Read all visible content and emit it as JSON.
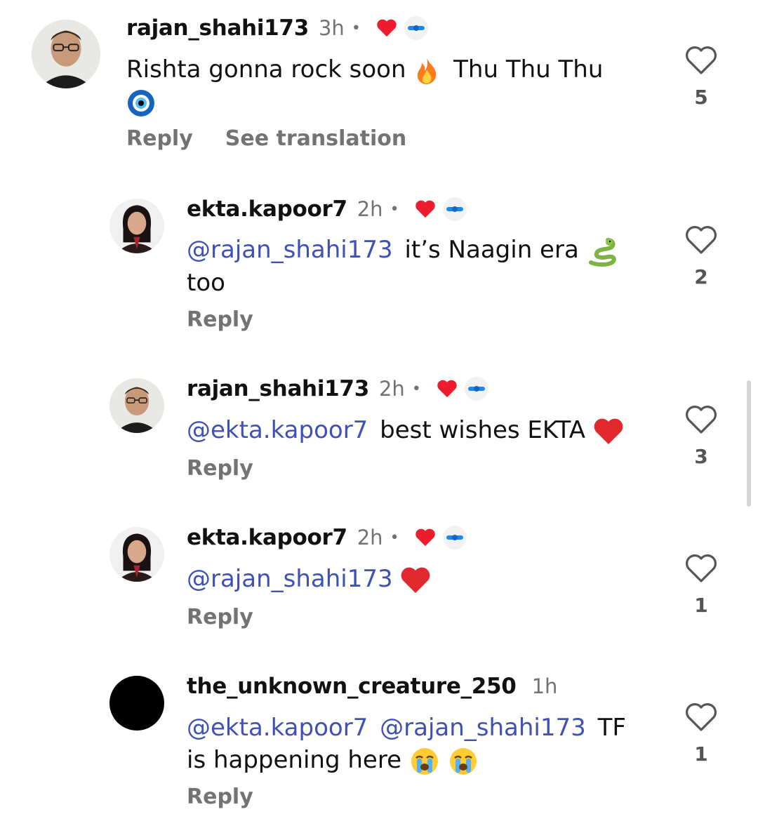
{
  "comments": [
    {
      "username": "rajan_shahi173",
      "time": "3h",
      "dot": "•",
      "text_before": "Rishta gonna rock soon",
      "text_after": "Thu Thu Thu",
      "reply_label": "Reply",
      "translate_label": "See translation",
      "likes": "5"
    },
    {
      "username": "ekta.kapoor7",
      "time": "2h",
      "dot": "•",
      "mention": "@rajan_shahi173",
      "text": "it’s Naagin era",
      "text_line2": "too",
      "reply_label": "Reply",
      "likes": "2"
    },
    {
      "username": "rajan_shahi173",
      "time": "2h",
      "dot": "•",
      "mention": "@ekta.kapoor7",
      "text": "best wishes EKTA",
      "reply_label": "Reply",
      "likes": "3"
    },
    {
      "username": "ekta.kapoor7",
      "time": "2h",
      "dot": "•",
      "mention": "@rajan_shahi173",
      "reply_label": "Reply",
      "likes": "1"
    },
    {
      "username": "the_unknown_creature_250",
      "time": "1h",
      "mention1": "@ekta.kapoor7",
      "mention2": "@rajan_shahi173",
      "text": "TF",
      "text_line2": "is happening here",
      "reply_label": "Reply",
      "likes": "1"
    }
  ],
  "colors": {
    "mention": "#3f51b5",
    "heart": "#ed1c2e",
    "muted": "#737373"
  },
  "icons": [
    "heart-outline-icon",
    "red-heart-icon",
    "fire-emoji",
    "nazar-emoji",
    "snake-emoji",
    "crying-emoji"
  ]
}
